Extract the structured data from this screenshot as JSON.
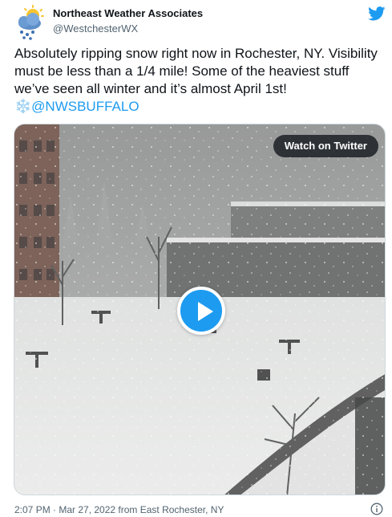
{
  "account": {
    "display_name": "Northeast Weather Associates",
    "handle": "@WestchesterWX",
    "avatar_icon": "weather-cloud-sun-snow-icon"
  },
  "tweet": {
    "text": "Absolutely ripping snow right now in Rochester, NY. Visibility must be less than a 1/4 mile! Some of the heaviest stuff we’ve seen all winter and it’s almost April 1st!",
    "emoji": "❄️",
    "mention": "@NWSBUFFALO"
  },
  "media": {
    "type": "video",
    "watch_label": "Watch on Twitter",
    "play_icon": "play-icon"
  },
  "footer": {
    "timestamp": "2:07 PM · Mar 27, 2022 from East Rochester, NY",
    "info_icon": "info-icon"
  },
  "brand": {
    "logo_icon": "twitter-bird-icon",
    "accent_color": "#1d9bf0"
  }
}
